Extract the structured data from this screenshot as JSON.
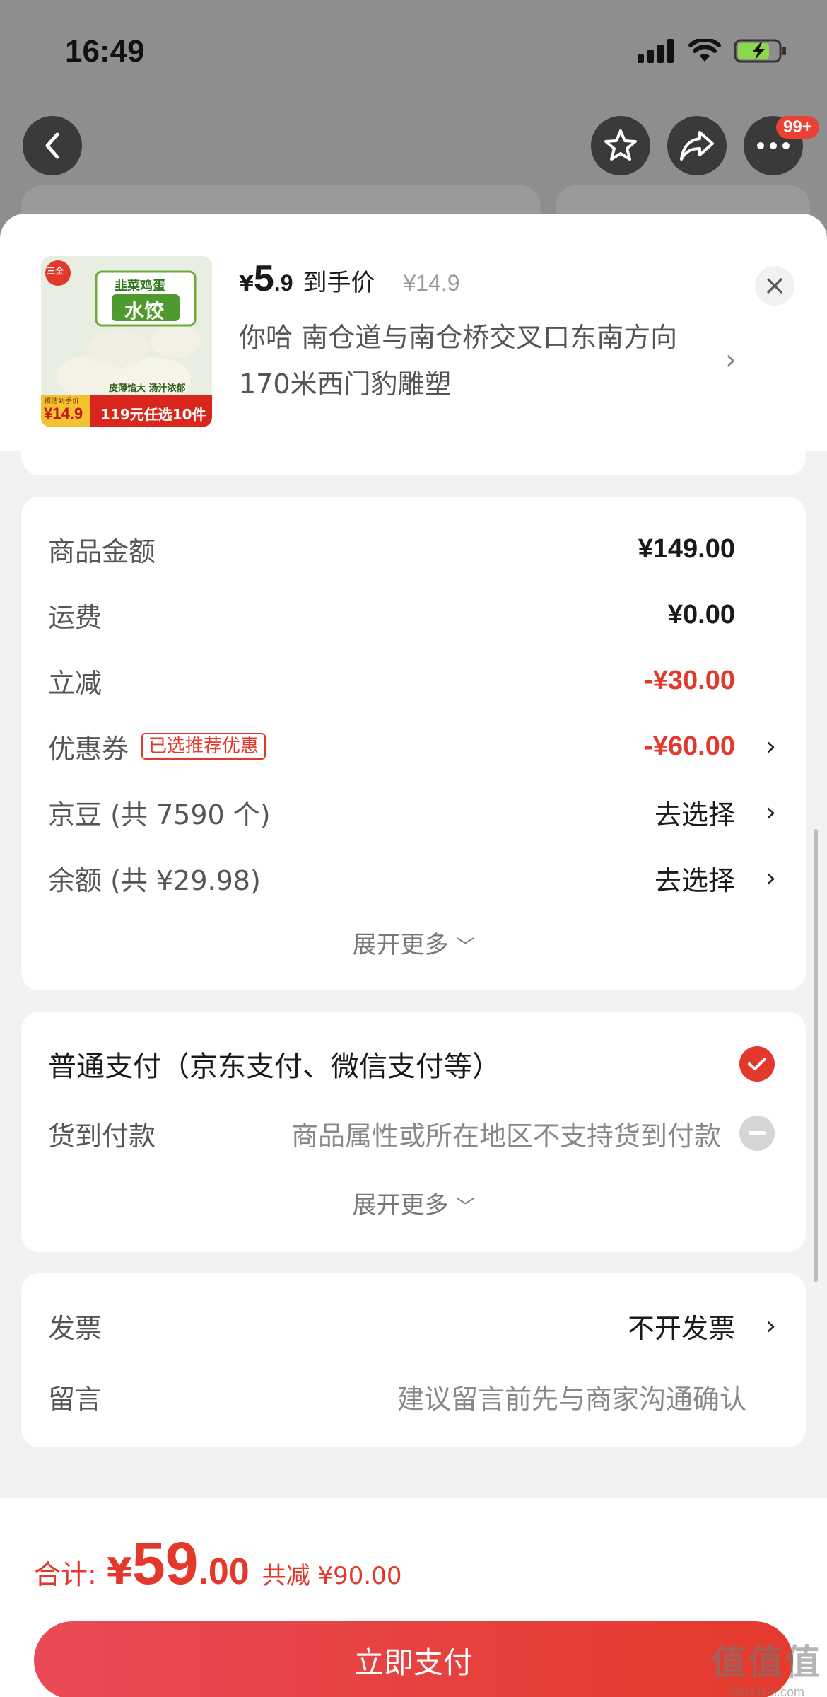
{
  "status_bar": {
    "time": "16:49"
  },
  "nav": {
    "badge": "99+"
  },
  "product": {
    "currency": "¥",
    "price_int": "5",
    "price_dec": ".9",
    "price_label": "到手价",
    "original_price": "¥14.9",
    "address": "你哈  南仓道与南仓桥交叉口东南方向170米西门豹雕塑",
    "thumb": {
      "brand": "三全",
      "name_top": "韭菜鸡蛋",
      "name_main": "水饺",
      "slogan": "皮薄馅大  汤汁浓郁",
      "promo_price_label": "预估到手价",
      "promo_price": "¥14.9",
      "promo_deal": "119元任选10件"
    }
  },
  "cost": {
    "rows": [
      {
        "label": "商品金额",
        "value": "¥149.00"
      },
      {
        "label": "运费",
        "value": "¥0.00"
      },
      {
        "label": "立减",
        "value": "-¥30.00"
      },
      {
        "label": "优惠券",
        "tag": "已选推荐优惠",
        "value": "-¥60.00"
      },
      {
        "label": "京豆 (共 7590 个)",
        "value": "去选择"
      },
      {
        "label": "余额 (共 ¥29.98)",
        "value": "去选择"
      }
    ],
    "expand": "展开更多"
  },
  "payment": {
    "primary": "普通支付（京东支付、微信支付等）",
    "cod_label": "货到付款",
    "cod_note": "商品属性或所在地区不支持货到付款",
    "expand": "展开更多"
  },
  "invoice": {
    "label": "发票",
    "value": "不开发票",
    "message_label": "留言",
    "message_placeholder": "建议留言前先与商家沟通确认"
  },
  "footer": {
    "total_label": "合计:",
    "currency": "¥",
    "total_int": "59",
    "total_dec": ".00",
    "savings": "共减 ¥90.00",
    "pay_button": "立即支付"
  },
  "watermark": {
    "text": "值值值",
    "url": "zhizhizhi.com"
  },
  "colors": {
    "accent": "#e3382c",
    "check": "#e3382c"
  }
}
